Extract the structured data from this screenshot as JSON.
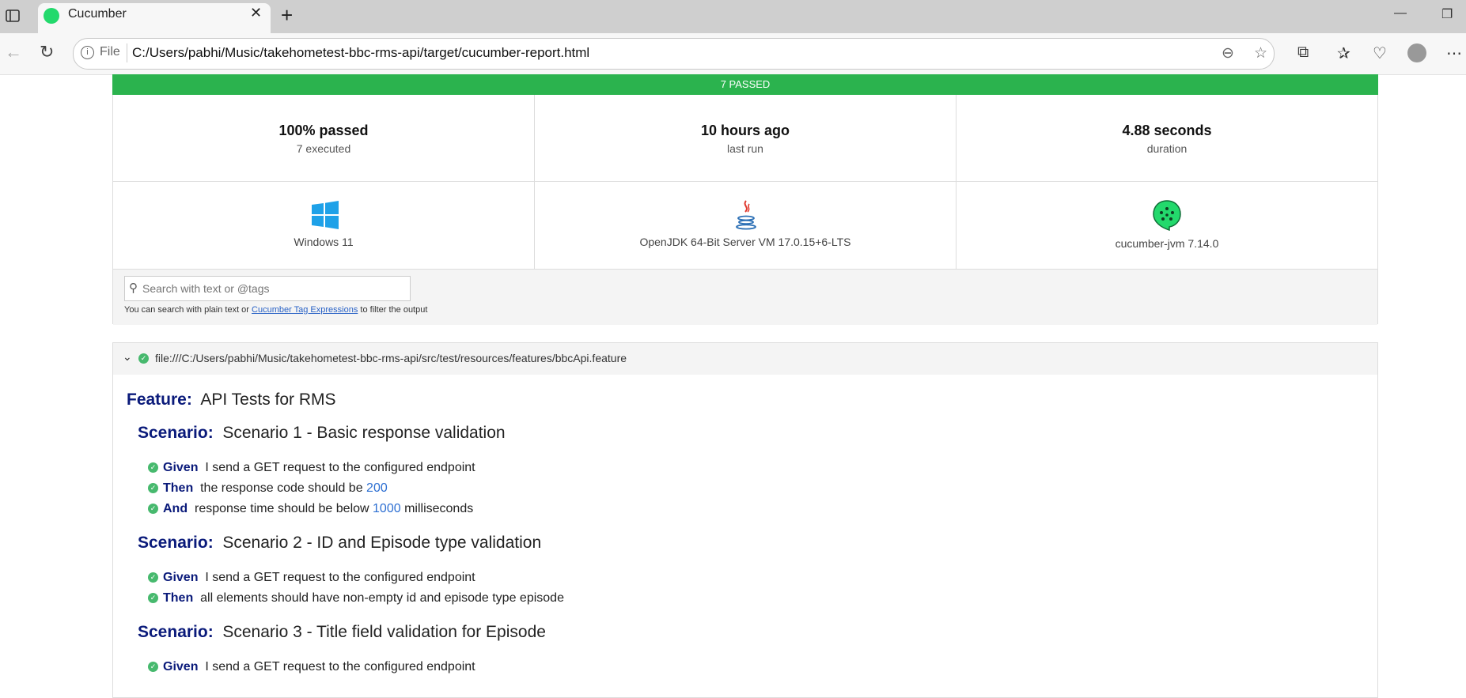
{
  "browser": {
    "tab_title": "Cucumber",
    "file_label": "File",
    "url": "C:/Users/pabhi/Music/takehometest-bbc-rms-api/target/cucumber-report.html"
  },
  "report": {
    "banner": "7 PASSED",
    "stats": [
      {
        "value": "100% passed",
        "label": "7 executed"
      },
      {
        "value": "10 hours ago",
        "label": "last run"
      },
      {
        "value": "4.88 seconds",
        "label": "duration"
      }
    ],
    "env": [
      {
        "label": "Windows 11"
      },
      {
        "label": "OpenJDK 64-Bit Server VM 17.0.15+6-LTS"
      },
      {
        "label": "cucumber-jvm 7.14.0"
      }
    ],
    "search": {
      "placeholder": "Search with text or @tags",
      "hint_prefix": "You can search with plain text or",
      "hint_link": "Cucumber Tag Expressions",
      "hint_suffix": "to filter the output"
    }
  },
  "feature_file": {
    "path": "file:///C:/Users/pabhi/Music/takehometest-bbc-rms-api/src/test/resources/features/bbcApi.feature",
    "feature_keyword": "Feature:",
    "feature_name": "API Tests for RMS",
    "scenarios": [
      {
        "keyword": "Scenario:",
        "name": "Scenario 1 - Basic response validation",
        "steps": [
          {
            "keyword": "Given",
            "text": "I send a GET request to the configured endpoint"
          },
          {
            "keyword": "Then",
            "text_before": "the response code should be",
            "param": "200",
            "text_after": ""
          },
          {
            "keyword": "And",
            "text_before": "response time should be below",
            "param": "1000",
            "text_after": "milliseconds"
          }
        ]
      },
      {
        "keyword": "Scenario:",
        "name": "Scenario 2 - ID and Episode type validation",
        "steps": [
          {
            "keyword": "Given",
            "text": "I send a GET request to the configured endpoint"
          },
          {
            "keyword": "Then",
            "text": "all elements should have non-empty id and episode type episode"
          }
        ]
      },
      {
        "keyword": "Scenario:",
        "name": "Scenario 3 - Title field validation for Episode",
        "steps": [
          {
            "keyword": "Given",
            "text": "I send a GET request to the configured endpoint"
          }
        ]
      }
    ]
  },
  "colors": {
    "passed": "#2bb34e",
    "keyword": "#0a1a7a",
    "param": "#2d6fd2"
  }
}
